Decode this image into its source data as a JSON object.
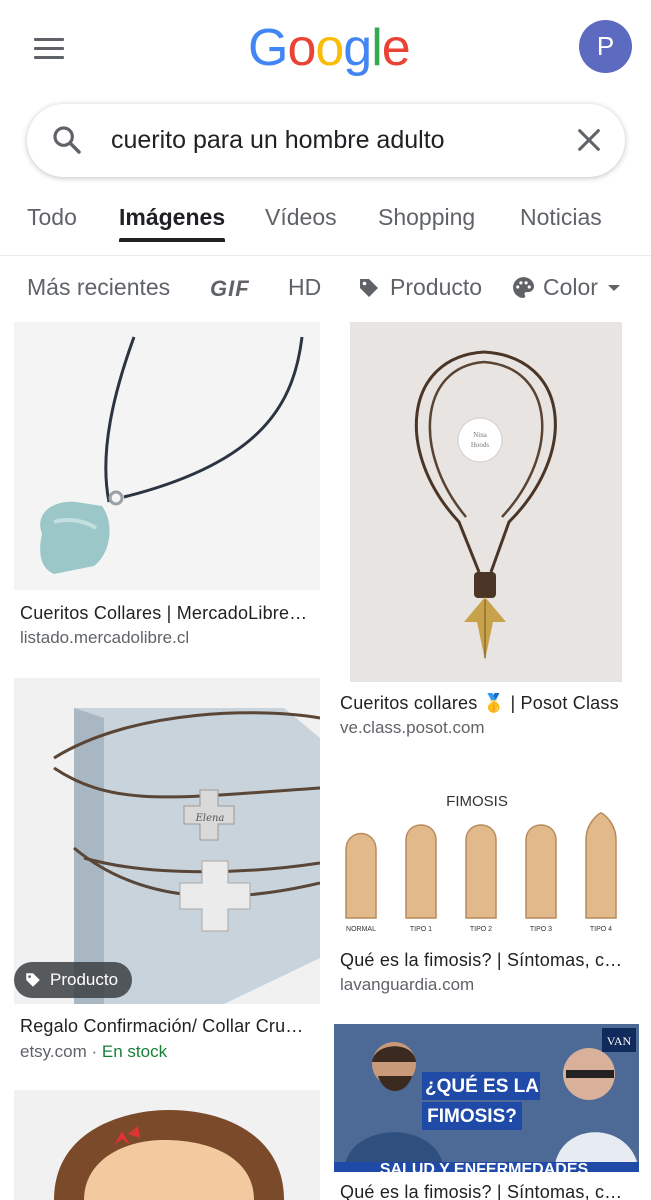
{
  "header": {
    "logo_letters": [
      "G",
      "o",
      "o",
      "g",
      "l",
      "e"
    ],
    "logo_colors": [
      "#4285F4",
      "#EA4335",
      "#FBBC05",
      "#4285F4",
      "#34A853",
      "#EA4335"
    ],
    "avatar_initial": "P",
    "avatar_color": "#5c6bc0"
  },
  "search": {
    "query": "cuerito para un hombre adulto"
  },
  "tabs": [
    "Todo",
    "Imágenes",
    "Vídeos",
    "Shopping",
    "Noticias"
  ],
  "active_tab": "Imágenes",
  "filters": {
    "recent": "Más recientes",
    "gif": "GIF",
    "hd": "HD",
    "product": "Producto",
    "color": "Color"
  },
  "results": [
    {
      "title": "Cueritos Collares | MercadoLibre…",
      "source": "listado.mercadolibre.cl"
    },
    {
      "title": "Cueritos collares 🥇 | Posot Class",
      "source": "ve.class.posot.com"
    },
    {
      "title": "Regalo Confirmación/ Collar Cru…",
      "source": "etsy.com",
      "source_sep": " · ",
      "stock": "En stock",
      "badge": "Producto"
    },
    {
      "title": "Qué es la fimosis? | Síntomas, c…",
      "source": "lavanguardia.com"
    },
    {
      "title": "Qué es la fimosis? | Síntomas, c…"
    }
  ],
  "image_text": {
    "fimosis_heading": "FIMOSIS",
    "fimosis_labels": [
      "NORMAL",
      "TIPO 1",
      "TIPO 2",
      "TIPO 3",
      "TIPO 4"
    ],
    "video_caption_1": "¿QUÉ ES LA",
    "video_caption_2": "FIMOSIS?",
    "video_lower": "SALUD Y ENFERMEDADES",
    "video_logo": "VAN",
    "pendant_engraving": "Elena",
    "logo_badge_line1": "Nina",
    "logo_badge_line2": "Hoods"
  }
}
